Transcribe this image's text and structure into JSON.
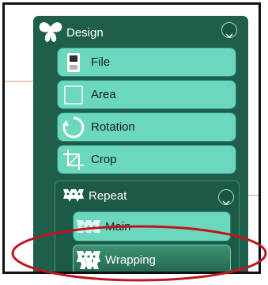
{
  "design": {
    "title": "Design",
    "items": [
      {
        "label": "File",
        "icon": "file-icon"
      },
      {
        "label": "Area",
        "icon": "area-icon"
      },
      {
        "label": "Rotation",
        "icon": "rotation-icon"
      },
      {
        "label": "Crop",
        "icon": "crop-icon"
      }
    ]
  },
  "repeat": {
    "title": "Repeat",
    "items": [
      {
        "label": "Main",
        "icon": "main-pattern-icon"
      },
      {
        "label": "Wrapping",
        "icon": "wrapping-pattern-icon"
      }
    ]
  },
  "colors": {
    "panel": "#1f5e4c",
    "item": "#6bd7bc",
    "selected": "#2e7a5f",
    "annotation": "#c0151e"
  }
}
